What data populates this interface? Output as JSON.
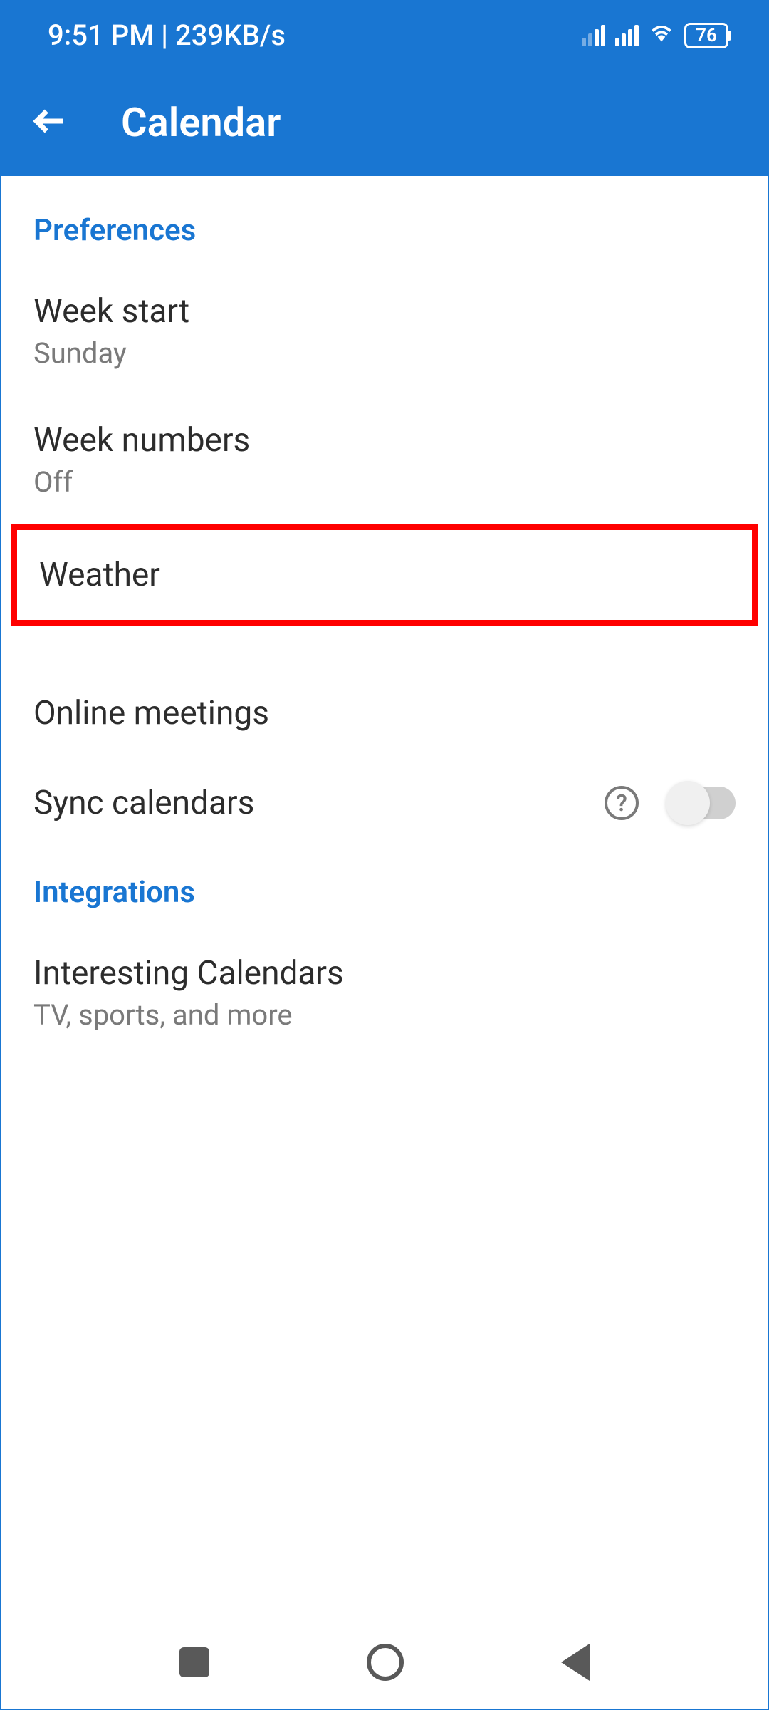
{
  "status_bar": {
    "time_net": "9:51 PM | 239KB/s",
    "battery": "76"
  },
  "app_bar": {
    "title": "Calendar"
  },
  "sections": {
    "preferences": {
      "header": "Preferences",
      "week_start": {
        "title": "Week start",
        "value": "Sunday"
      },
      "week_numbers": {
        "title": "Week numbers",
        "value": "Off"
      },
      "weather": {
        "title": "Weather"
      },
      "online_meetings": {
        "title": "Online meetings"
      },
      "sync_calendars": {
        "title": "Sync calendars"
      }
    },
    "integrations": {
      "header": "Integrations",
      "interesting_calendars": {
        "title": "Interesting Calendars",
        "subtitle": "TV, sports, and more"
      }
    }
  }
}
